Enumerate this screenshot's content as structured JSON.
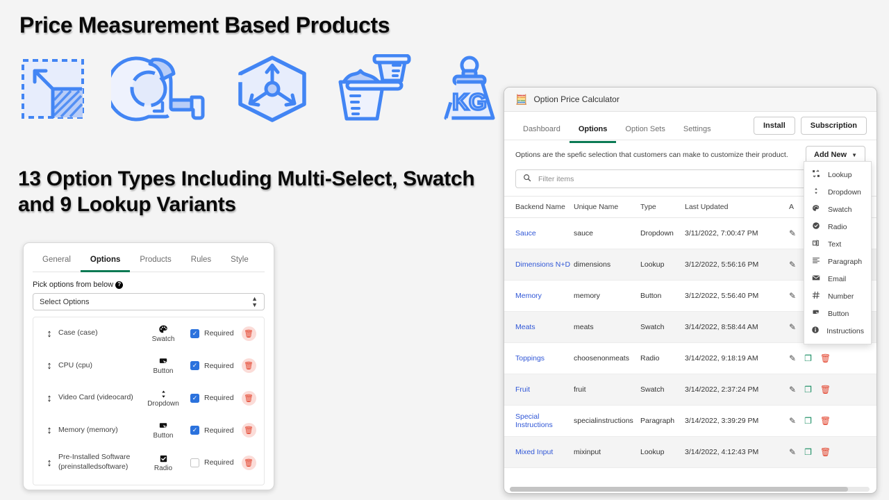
{
  "promo": {
    "headline1": "Price Measurement Based Products",
    "headline2": "13 Option Types Including Multi-Select, Swatch and 9 Lookup Variants",
    "icons": [
      {
        "name": "area-measure-icon",
        "label": "Area"
      },
      {
        "name": "tape-measure-icon",
        "label": "Tape Measure"
      },
      {
        "name": "volume-3d-icon",
        "label": "Volume"
      },
      {
        "name": "measuring-cup-icon",
        "label": "Measuring Cup"
      },
      {
        "name": "weight-kg-icon",
        "label": "Weight KG"
      }
    ],
    "accent_color": "#4285f4",
    "icon_fill_color": "#dce6fb"
  },
  "left_card": {
    "tabs": [
      {
        "label": "General",
        "active": false
      },
      {
        "label": "Options",
        "active": true
      },
      {
        "label": "Products",
        "active": false
      },
      {
        "label": "Rules",
        "active": false
      },
      {
        "label": "Style",
        "active": false
      }
    ],
    "pick_label": "Pick options from below",
    "help_glyph": "?",
    "select_value": "Select Options",
    "required_label": "Required",
    "rows": [
      {
        "name": "Case (case)",
        "type": "Swatch",
        "type_icon": "palette-icon",
        "required": true
      },
      {
        "name": "CPU (cpu)",
        "type": "Button",
        "type_icon": "button-cursor-icon",
        "required": true
      },
      {
        "name": "Video Card (videocard)",
        "type": "Dropdown",
        "type_icon": "chevron-updown-icon",
        "required": true
      },
      {
        "name": "Memory (memory)",
        "type": "Button",
        "type_icon": "button-cursor-icon",
        "required": true
      },
      {
        "name": "Pre-Installed Software (preinstalledsoftware)",
        "type": "Radio",
        "type_icon": "checkbox-filled-icon",
        "required": false
      }
    ],
    "active_tab_color": "#0b7a54",
    "checkbox_color": "#2b72dd",
    "delete_color": "#e2412a"
  },
  "right_window": {
    "title": "Option Price Calculator",
    "app_icon": "calculator-icon",
    "tabs": [
      {
        "label": "Dashboard",
        "active": false
      },
      {
        "label": "Options",
        "active": true
      },
      {
        "label": "Option Sets",
        "active": false
      },
      {
        "label": "Settings",
        "active": false
      }
    ],
    "buttons": {
      "install": "Install",
      "subscription": "Subscription",
      "add_new": "Add New"
    },
    "subtitle": "Options are the spefic selection that customers can make to customize their product.",
    "search": {
      "placeholder": "Filter items",
      "value": "",
      "icon": "search-icon"
    },
    "table": {
      "headers": [
        "Backend Name",
        "Unique Name",
        "Type",
        "Last Updated",
        "A"
      ],
      "rows": [
        {
          "backend_name": "Sauce",
          "unique_name": "sauce",
          "type": "Dropdown",
          "last_updated": "3/11/2022, 7:00:47 PM"
        },
        {
          "backend_name": "Dimensions N+D",
          "unique_name": "dimensions",
          "type": "Lookup",
          "last_updated": "3/12/2022, 5:56:16 PM"
        },
        {
          "backend_name": "Memory",
          "unique_name": "memory",
          "type": "Button",
          "last_updated": "3/12/2022, 5:56:40 PM"
        },
        {
          "backend_name": "Meats",
          "unique_name": "meats",
          "type": "Swatch",
          "last_updated": "3/14/2022, 8:58:44 AM"
        },
        {
          "backend_name": "Toppings",
          "unique_name": "choosenonmeats",
          "type": "Radio",
          "last_updated": "3/14/2022, 9:18:19 AM"
        },
        {
          "backend_name": "Fruit",
          "unique_name": "fruit",
          "type": "Swatch",
          "last_updated": "3/14/2022, 2:37:24 PM"
        },
        {
          "backend_name": "Special Instructions",
          "unique_name": "specialinstructions",
          "type": "Paragraph",
          "last_updated": "3/14/2022, 3:39:29 PM"
        },
        {
          "backend_name": "Mixed Input",
          "unique_name": "mixinput",
          "type": "Lookup",
          "last_updated": "3/14/2022, 4:12:43 PM"
        }
      ],
      "link_color": "#2f56d6"
    },
    "add_new_menu": [
      {
        "label": "Lookup",
        "icon": "lookup-icon"
      },
      {
        "label": "Dropdown",
        "icon": "chevron-updown-icon"
      },
      {
        "label": "Swatch",
        "icon": "palette-icon"
      },
      {
        "label": "Radio",
        "icon": "radio-check-icon"
      },
      {
        "label": "Text",
        "icon": "text-field-icon"
      },
      {
        "label": "Paragraph",
        "icon": "paragraph-icon"
      },
      {
        "label": "Email",
        "icon": "envelope-icon"
      },
      {
        "label": "Number",
        "icon": "hash-icon"
      },
      {
        "label": "Button",
        "icon": "button-cursor-icon"
      },
      {
        "label": "Instructions",
        "icon": "info-icon"
      }
    ],
    "row_action_icons": [
      "edit-icon",
      "duplicate-icon",
      "delete-icon"
    ]
  }
}
